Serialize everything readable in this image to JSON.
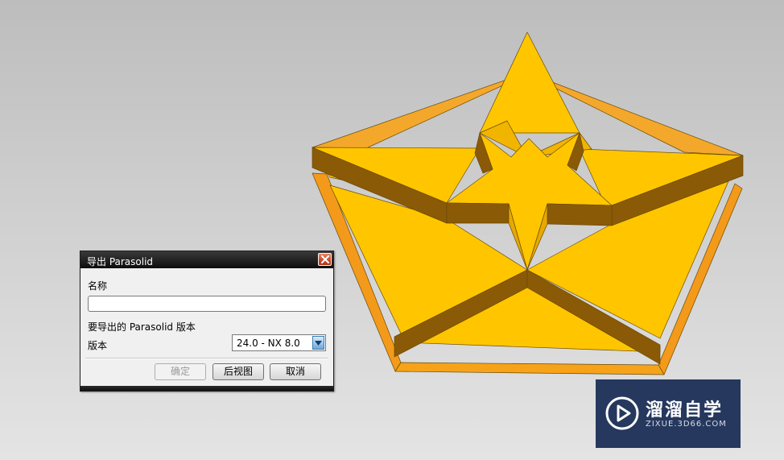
{
  "dialog": {
    "title": "导出 Parasolid",
    "name_label": "名称",
    "name_value": "",
    "version_section_label": "要导出的 Parasolid 版本",
    "version_label": "版本",
    "version_selected": "24.0 - NX 8.0",
    "buttons": {
      "ok": "确定",
      "back_view": "后视图",
      "cancel": "取消"
    }
  },
  "watermark": {
    "brand": "溜溜自学",
    "url": "ZIXUE.3D66.COM"
  },
  "colors": {
    "model_face": "#ffc600",
    "model_side": "#ffa500",
    "model_shadow": "#8b5a06",
    "dialog_titlebar": "#111111",
    "close_button": "#c94a2c",
    "watermark_bg": "#26385e"
  }
}
